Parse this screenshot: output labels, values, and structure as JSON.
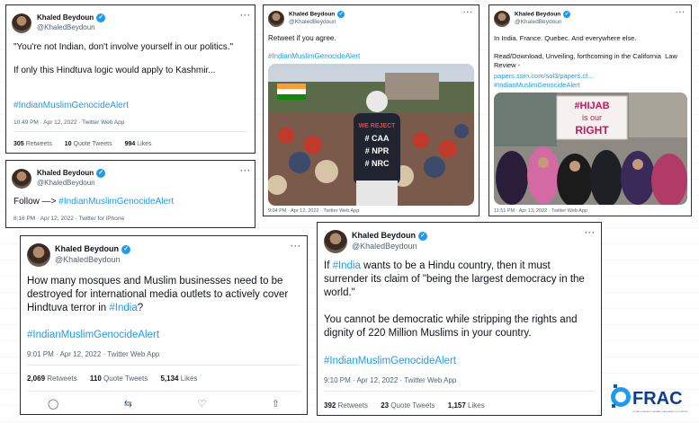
{
  "author": {
    "name": "Khaled Beydoun",
    "handle": "@KhaledBeydoun"
  },
  "watermark": "DFRAC",
  "tweets": [
    {
      "text": "\"You're not Indian, don't involve yourself in our politics.\"\n\nIf only this Hindtuva logic would apply to Kashmir...",
      "hashtag": "#IndianMuslimGenocideAlert",
      "meta": "10:49 PM · Apr 12, 2022 · Twitter Web App",
      "retweets": "305",
      "retweets_label": "Retweets",
      "quotes": "10",
      "quotes_label": "Quote Tweets",
      "likes": "994",
      "likes_label": "Likes"
    },
    {
      "text_prefix": "Follow —> ",
      "hashtag": "#IndianMuslimGenocideAlert",
      "meta": "8:16 PM · Apr 12, 2022 · Twitter for iPhone"
    },
    {
      "text": "Retweet if you agree.",
      "hashtag": "#IndianMuslimGenocideAlert",
      "meta": "9:04 PM · Apr 12, 2022 · Twitter Web App",
      "photo_lines": [
        "WE REJECT",
        "# CAA",
        "# NPR",
        "# NRC"
      ]
    },
    {
      "text": "In India. France. Quebec. And everywhere else.\n\nRead/Download, Unveiling, forthcoming in the California  Law Review -",
      "link": "papers.ssrn.com/sol3/papers.cf...",
      "hashtag": "#IndianMuslimGenocideAlert",
      "meta": "11:51 PM · Apr 13, 2022 · Twitter Web App",
      "sign_lines": [
        "#HIJAB",
        "is our",
        "RIGHT"
      ]
    },
    {
      "text": "How many mosques and Muslim businesses need to be destroyed for international media outlets to actively cover Hindtuva terror in ",
      "inline_tag": "#India",
      "text_suffix": "?",
      "hashtag": "#IndianMuslimGenocideAlert",
      "meta": "9:01 PM · Apr 12, 2022 · Twitter Web App",
      "retweets": "2,069",
      "retweets_label": "Retweets",
      "quotes": "110",
      "quotes_label": "Quote Tweets",
      "likes": "5,134",
      "likes_label": "Likes"
    },
    {
      "text_prefix": "If ",
      "inline_tag": "#India",
      "text": " wants to be a Hindu country, then it must surrender its claim of \"being the largest democracy in the world.\"\n\nYou cannot be democratic while stripping the rights and dignity of 220 Million Muslims in your country.",
      "hashtag": "#IndianMuslimGenocideAlert",
      "meta": "9:10 PM · Apr 12, 2022 · Twitter Web App",
      "retweets": "392",
      "retweets_label": "Retweets",
      "quotes": "23",
      "quotes_label": "Quote Tweets",
      "likes": "1,157",
      "likes_label": "Likes"
    }
  ],
  "logo": {
    "text": "FRAC",
    "tagline": "DIGITAL FORENSICS RESEARCH AND ANALYTICS CENTRE"
  },
  "colors": {
    "link": "#1d9bf0",
    "secondary": "#536471",
    "border": "#2b2b2b"
  }
}
